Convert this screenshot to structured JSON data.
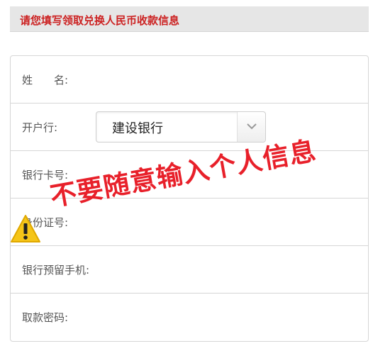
{
  "notice": {
    "text": "请您填写领取兑换人民币收款信息"
  },
  "form": {
    "name_label": "姓　　名:",
    "name_value": "",
    "bank_label": "开户行:",
    "bank_selected": "建设银行",
    "card_label": "银行卡号:",
    "card_value": "",
    "id_label": "身份证号:",
    "id_value": "",
    "phone_label": "银行预留手机:",
    "phone_value": "",
    "password_label": "取款密码:",
    "password_value": ""
  },
  "overlay": {
    "warning_text": "不要随意输入个人信息",
    "warning_icon": "warning-triangle-icon"
  },
  "colors": {
    "notice_text": "#cc2222",
    "warning_text": "#e8202a",
    "warning_icon_fill": "#f5c518"
  }
}
